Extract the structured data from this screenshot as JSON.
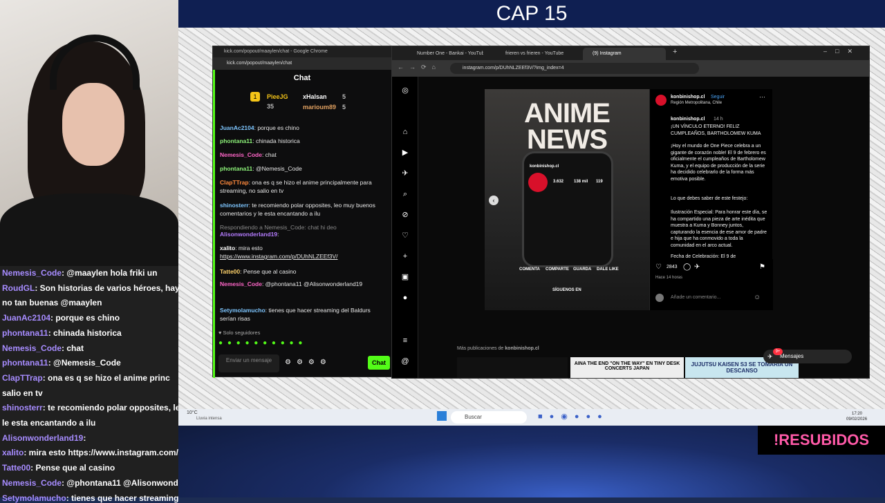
{
  "overlay": {
    "title": "CAP 15",
    "badge": "!RESUBIDOS"
  },
  "side_chat": [
    {
      "user": "Nemesis_Code",
      "msg": ": @maaylen hola friki un"
    },
    {
      "user": "RoudGL",
      "msg": ": Son historias de varios héroes, hay"
    },
    {
      "user": "",
      "msg": "no tan buenas @maaylen"
    },
    {
      "user": "JuanAc2104",
      "msg": ": porque es chino"
    },
    {
      "user": "phontana11",
      "msg": ": chinada historica"
    },
    {
      "user": "Nemesis_Code",
      "msg": ": chat"
    },
    {
      "user": "phontana11",
      "msg": ": @Nemesis_Code"
    },
    {
      "user": "ClapTTrap",
      "msg": ": ona es q se hizo el anime princ"
    },
    {
      "user": "",
      "msg": "salio en tv"
    },
    {
      "user": "shinosterr",
      "msg": ": te recomiendo polar opposites, le"
    },
    {
      "user": "",
      "msg": "le esta encantando a ilu"
    },
    {
      "user": "Alisonwonderland19",
      "msg": ":"
    },
    {
      "user": "xalito",
      "msg": ": mira esto https://www.instagram.com/p/"
    },
    {
      "user": "Tatte00",
      "msg": ": Pense que al casino"
    },
    {
      "user": "Nemesis_Code",
      "msg": ": @phontana11 @Alisonwond"
    },
    {
      "user": "Setymolamucho",
      "msg": ": tienes que hacer streaming"
    }
  ],
  "chat_window": {
    "titlebar": "kick.com/popout/maaylen/chat - Google Chrome",
    "url": "kick.com/popout/maaylen/chat",
    "header": "Chat",
    "leaders": [
      {
        "name": "PieeJG",
        "count": "35"
      },
      {
        "name": "xHalsan",
        "count": "5"
      },
      {
        "name": "marioum89",
        "count": "5"
      }
    ],
    "messages": [
      {
        "user": "JuanAc2104",
        "msg": ": porque es chino"
      },
      {
        "user": "phontana11",
        "msg": ": chinada historica"
      },
      {
        "user": "Nemesis_Code",
        "msg": ": chat"
      },
      {
        "user": "phontana11",
        "msg": ": @Nemesis_Code"
      },
      {
        "user": "ClapTTrap",
        "msg": ": ona es q se hizo el anime principalmente para streaming, no salio en tv"
      },
      {
        "user": "shinosterr",
        "msg": ": te recomiendo polar opposites, leo muy buenos comentarios y le esta encantando a ilu"
      },
      {
        "user": "",
        "msg": "Respondiendo a Nemesis_Code: chat hi deo"
      },
      {
        "user": "Alisonwonderland19",
        "msg": ":"
      },
      {
        "user": "xalito",
        "msg": ": mira esto"
      },
      {
        "user": "",
        "msg": "https://www.instagram.com/p/DUhNLZEEf3V/"
      },
      {
        "user": "Tatte00",
        "msg": ": Pense que al casino"
      },
      {
        "user": "Nemesis_Code",
        "msg": ": @phontana11 @Alisonwonderland19"
      },
      {
        "user": "Setymolamucho",
        "msg": ": tienes que hacer streaming del Baldurs serían risas"
      }
    ],
    "followers_only": "Solo seguidores",
    "input_placeholder": "Enviar un mensaje",
    "send": "Chat"
  },
  "browser": {
    "tabs": [
      "Number One - Bankai - YouTube",
      "frieren vs frieren - YouTube",
      "(9) Instagram"
    ],
    "url": "instagram.com/p/DUhNLZEEf3V/?img_index=4",
    "post": {
      "image_title": "ANIME NEWS",
      "phone_user": "konbinishop.cl",
      "phone_stats": [
        "3.632",
        "138 mil",
        "119"
      ],
      "actions": [
        "COMENTA",
        "COMPARTE",
        "GUARDA",
        "DALE LIKE"
      ],
      "footer": "SÍGUENOS EN",
      "account": "konbinishop.cl",
      "follow": "Seguir",
      "location": "Región Metropolitana, Chile",
      "caption_user": "konbinishop.cl",
      "caption_time": "14 h",
      "caption": "¡UN VÍNCULO ETERNO! FELIZ CUMPLEAÑOS, BARTHOLOMEW KUMA",
      "body1": "¡Hoy el mundo de One Piece celebra a un gigante de corazón noble! El 9 de febrero es oficialmente el cumpleaños de Bartholomew Kuma, y el equipo de producción de la serie ha decidido celebrarlo de la forma más emotiva posible.",
      "body2": "Lo que debes saber de este festejo:",
      "body3": "Ilustración Especial: Para honrar este día, se ha compartido una pieza de arte inédita que muestra a Kuma y Bonney juntos, capturando la esencia de ese amor de padre e hija que ha conmovido a toda la comunidad en el arco actual.",
      "body4": "Fecha de Celebración: El 9 de",
      "likes": "2843",
      "time": "Hace 14 horas",
      "comment_placeholder": "Añade un comentario..."
    },
    "more_from": "Más publicaciones de",
    "more_user": "konbinishop.cl",
    "thumb2": "AINA THE END \"ON THE WAY\" EN TINY DESK CONCERTS JAPAN",
    "thumb3": "JUJUTSU KAISEN S3 SE TOMARIA UN DESCANSO",
    "messages_btn": "Mensajes",
    "notif_count": "9+"
  },
  "taskbar": {
    "weather_temp": "10°C",
    "weather_desc": "Lluvia intensa",
    "search": "Buscar",
    "time": "17:20",
    "date": "09/02/2026"
  }
}
